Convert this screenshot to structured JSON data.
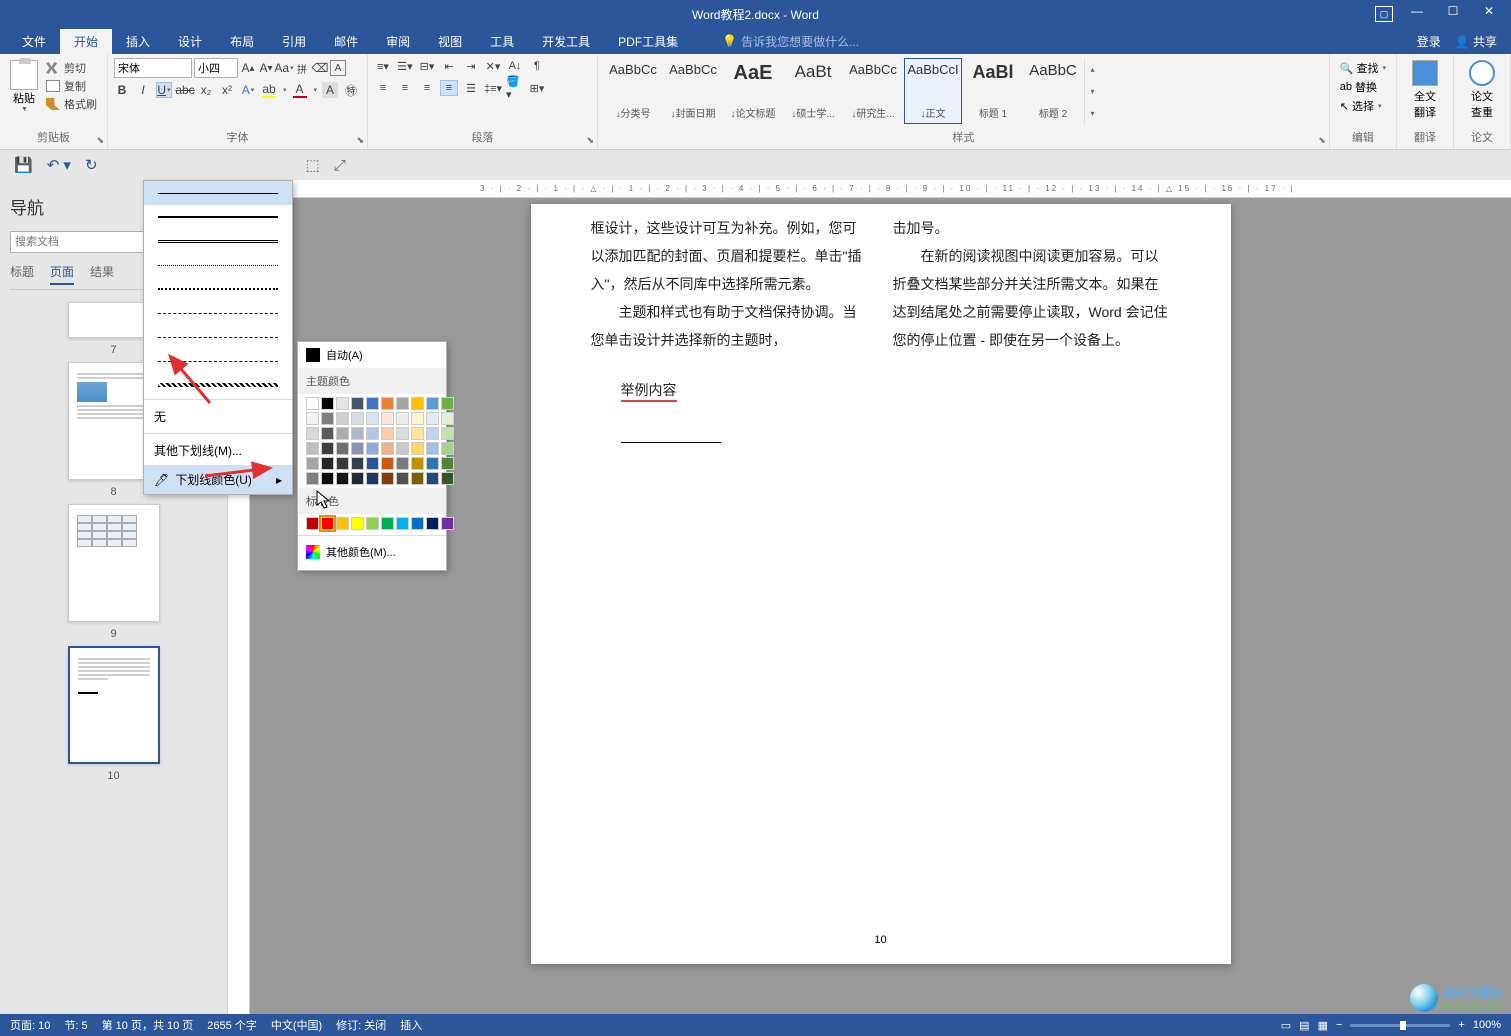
{
  "title": "Word教程2.docx - Word",
  "win": {
    "login": "登录",
    "share": "共享"
  },
  "tabs": {
    "file": "文件",
    "home": "开始",
    "insert": "插入",
    "design": "设计",
    "layout": "布局",
    "ref": "引用",
    "mail": "邮件",
    "review": "审阅",
    "view": "视图",
    "tools": "工具",
    "dev": "开发工具",
    "pdf": "PDF工具集",
    "tellme": "告诉我您想要做什么..."
  },
  "ribbon": {
    "clipboard": {
      "paste": "粘贴",
      "cut": "剪切",
      "copy": "复制",
      "painter": "格式刷",
      "label": "剪贴板"
    },
    "font": {
      "name": "宋体",
      "size": "小四",
      "label": "字体"
    },
    "para": {
      "label": "段落"
    },
    "styles": {
      "label": "样式",
      "items": [
        {
          "preview": "AaBbCc",
          "name": "↓分类号"
        },
        {
          "preview": "AaBbCc",
          "name": "↓封面日期"
        },
        {
          "preview": "AaE",
          "name": "↓论文标题"
        },
        {
          "preview": "AaBt",
          "name": "↓硕士学..."
        },
        {
          "preview": "AaBbCc",
          "name": "↓研究生..."
        },
        {
          "preview": "AaBbCcI",
          "name": "↓正文"
        },
        {
          "preview": "AaBl",
          "name": "标题 1"
        },
        {
          "preview": "AaBbC",
          "name": "标题 2"
        }
      ]
    },
    "editing": {
      "find": "查找",
      "replace": "替换",
      "select": "选择",
      "label": "编辑"
    },
    "translate": {
      "full": "全文\n翻译",
      "label": "翻译"
    },
    "lookup": {
      "full": "论文\n查重",
      "label": "论文"
    }
  },
  "nav": {
    "title": "导航",
    "search_ph": "搜索文档",
    "tabs": {
      "headings": "标题",
      "pages": "页面",
      "results": "结果"
    },
    "thumbs": [
      {
        "num": "7"
      },
      {
        "num": "8"
      },
      {
        "num": "9"
      },
      {
        "num": "10"
      }
    ]
  },
  "underline_menu": {
    "none": "无",
    "more": "其他下划线(M)...",
    "color": "下划线颜色(U)"
  },
  "color_menu": {
    "auto": "自动(A)",
    "theme": "主题颜色",
    "std": "标准色",
    "more": "其他颜色(M)...",
    "theme_row1": [
      "#ffffff",
      "#000000",
      "#e7e6e6",
      "#44546a",
      "#4472c4",
      "#ed7d31",
      "#a5a5a5",
      "#ffc000",
      "#5b9bd5",
      "#70ad47"
    ],
    "theme_rows": [
      [
        "#f2f2f2",
        "#7f7f7f",
        "#d0cece",
        "#d6dce4",
        "#d9e2f3",
        "#fbe5d5",
        "#ededed",
        "#fff2cc",
        "#deebf6",
        "#e2efd9"
      ],
      [
        "#d8d8d8",
        "#595959",
        "#aeabab",
        "#adb9ca",
        "#b4c6e7",
        "#f7cbac",
        "#dbdbdb",
        "#fee599",
        "#bdd7ee",
        "#c5e0b3"
      ],
      [
        "#bfbfbf",
        "#3f3f3f",
        "#757070",
        "#8496b0",
        "#8eaadb",
        "#f4b183",
        "#c9c9c9",
        "#ffd965",
        "#9cc3e5",
        "#a8d08d"
      ],
      [
        "#a5a5a5",
        "#262626",
        "#3a3838",
        "#323f4f",
        "#2f5496",
        "#c55a11",
        "#7b7b7b",
        "#bf9000",
        "#2e75b5",
        "#538135"
      ],
      [
        "#7f7f7f",
        "#0c0c0c",
        "#171616",
        "#222a35",
        "#1f3864",
        "#833c0b",
        "#525252",
        "#7f6000",
        "#1e4e79",
        "#375623"
      ]
    ],
    "std_colors": [
      "#c00000",
      "#ff0000",
      "#ffc000",
      "#ffff00",
      "#92d050",
      "#00b050",
      "#00b0f0",
      "#0070c0",
      "#002060",
      "#7030a0"
    ]
  },
  "doc": {
    "para1": "框设计，这些设计可互为补充。例如，您可以添加匹配的封面、页眉和提要栏。单击\"插入\"，然后从不同库中选择所需元素。",
    "para2": "主题和样式也有助于文档保持协调。当您单击设计并选择新的主题时，",
    "para1b": "击加号。",
    "para2b": "在新的阅读视图中阅读更加容易。可以折叠文档某些部分并关注所需文本。如果在达到结尾处之前需要停止读取，Word 会记住您的停止位置 - 即使在另一个设备上。",
    "example": "举例内容",
    "pagenum": "10"
  },
  "ruler": "3 · | · 2 · | · 1 · | · △ · | · 1 · | · 2 · | · 3 · | · 4 · | · 5 · | · 6 · | · 7 · | · 8 · | · 9 · | · 10 · | · 11 · | · 12 · | · 13 · | · 14 · | △ 15 · | · 16 · | · 17 · |",
  "status": {
    "page": "页面: 10",
    "sec": "节: 5",
    "pages": "第 10 页，共 10 页",
    "words": "2655 个字",
    "lang": "中文(中国)",
    "track": "修订: 关闭",
    "insert": "插入",
    "zoom": "100%"
  },
  "watermark": "极光下载站",
  "watermark_url": "www.xz7.com"
}
